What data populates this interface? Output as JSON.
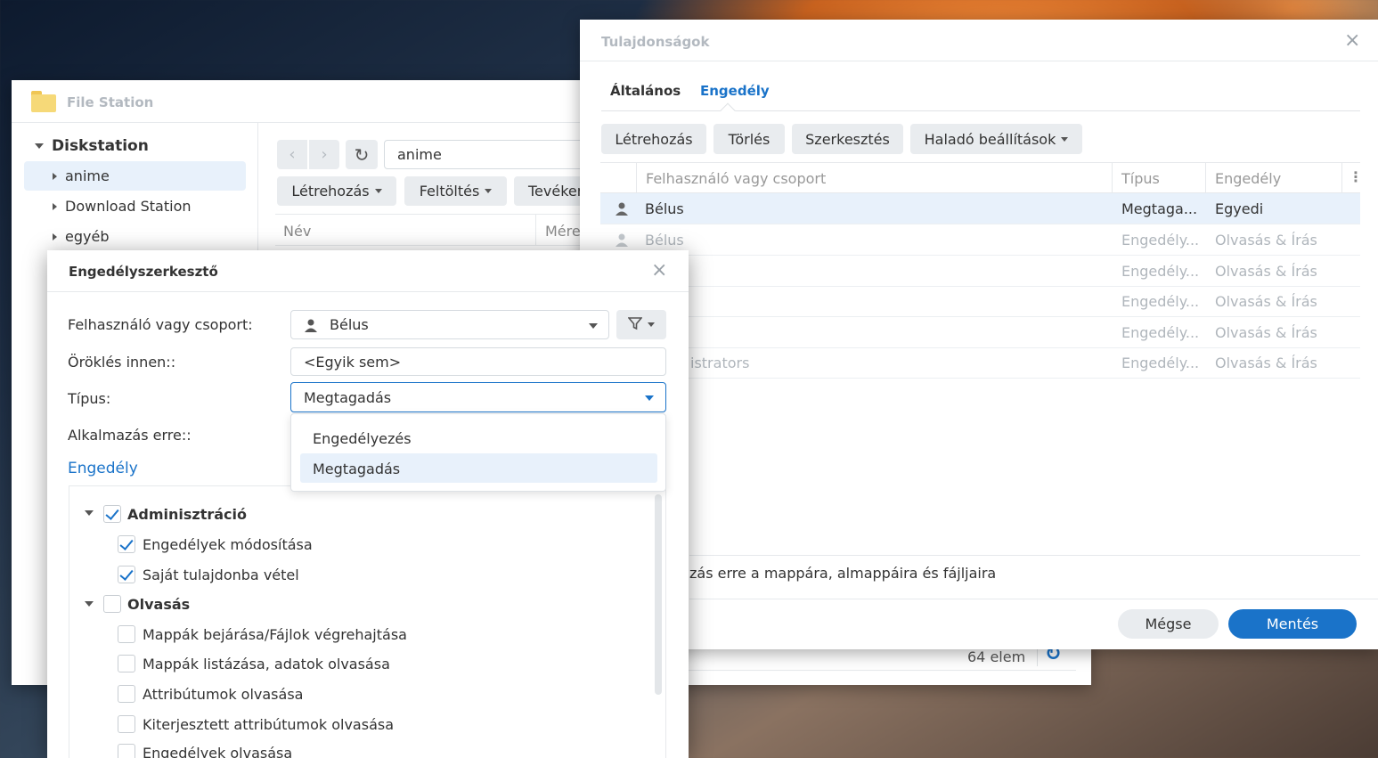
{
  "file_station": {
    "title": "File Station",
    "tree_root": "Diskstation",
    "tree_items": [
      "anime",
      "Download Station",
      "egyéb"
    ],
    "path": "anime",
    "toolbar": {
      "create": "Létrehozás",
      "upload": "Feltöltés",
      "action": "Tevéken"
    },
    "columns": {
      "name": "Név",
      "size": "Mére"
    },
    "status_count": "64 elem"
  },
  "properties": {
    "title": "Tulajdonságok",
    "tabs": [
      "Általános",
      "Engedély"
    ],
    "buttons": {
      "create": "Létrehozás",
      "delete": "Törlés",
      "edit": "Szerkesztés",
      "advanced": "Haladó beállítások"
    },
    "columns": {
      "user": "Felhasználó vagy csoport",
      "type": "Típus",
      "permission": "Engedély"
    },
    "rows": [
      {
        "user": "Bélus",
        "type": "Megtaga...",
        "permission": "Egyedi"
      },
      {
        "user": "Bélus",
        "type": "Engedély...",
        "permission": "Olvasás & Írás"
      },
      {
        "user": "",
        "type": "Engedély...",
        "permission": "Olvasás & Írás"
      },
      {
        "user": "",
        "type": "Engedély...",
        "permission": "Olvasás & Írás"
      },
      {
        "user": "",
        "type": "Engedély...",
        "permission": "Olvasás & Írás"
      },
      {
        "user": "istrators",
        "type": "Engedély...",
        "permission": "Olvasás & Írás"
      }
    ],
    "apply_text": "zás erre a mappára, almappáira és fájljaira",
    "cancel": "Mégse",
    "save": "Mentés"
  },
  "editor": {
    "title": "Engedélyszerkesztő",
    "labels": {
      "user": "Felhasználó vagy csoport:",
      "inherit": "Öröklés innen::",
      "type": "Típus:",
      "apply": "Alkalmazás erre::"
    },
    "user_value": "Bélus",
    "inherit_value": "<Egyik sem>",
    "type_value": "Megtagadás",
    "type_options": [
      "Engedélyezés",
      "Megtagadás"
    ],
    "section": "Engedély",
    "groups": [
      {
        "name": "Adminisztráció",
        "checked": true,
        "items": [
          {
            "label": "Engedélyek módosítása",
            "checked": true
          },
          {
            "label": "Saját tulajdonba vétel",
            "checked": true
          }
        ]
      },
      {
        "name": "Olvasás",
        "checked": false,
        "items": [
          {
            "label": "Mappák bejárása/Fájlok végrehajtása",
            "checked": false
          },
          {
            "label": "Mappák listázása, adatok olvasása",
            "checked": false
          },
          {
            "label": "Attribútumok olvasása",
            "checked": false
          },
          {
            "label": "Kiterjesztett attribútumok olvasása",
            "checked": false
          },
          {
            "label": "Engedélyek olvasása",
            "checked": false
          }
        ]
      }
    ]
  },
  "colors": {
    "accent": "#1a73c9",
    "selected_row": "#e8f1fb"
  }
}
